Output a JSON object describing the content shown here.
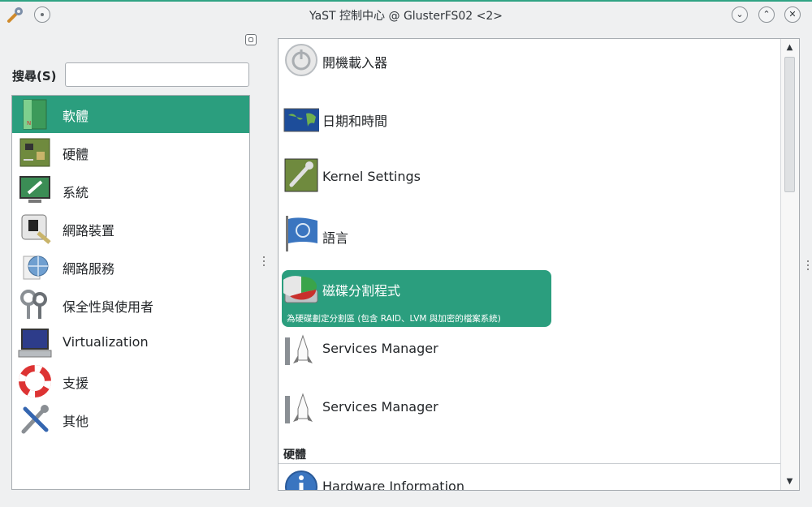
{
  "window": {
    "title": "YaST 控制中心 @ GlusterFS02 <2>",
    "buttons": [
      "chevron-down",
      "chevron-up",
      "close"
    ]
  },
  "search": {
    "label": "搜尋(S)",
    "value": "",
    "placeholder": ""
  },
  "categories": [
    {
      "label": "軟體",
      "icon": "software-package-icon",
      "selected": true
    },
    {
      "label": "硬體",
      "icon": "hardware-board-icon",
      "selected": false
    },
    {
      "label": "系統",
      "icon": "system-monitor-icon",
      "selected": false
    },
    {
      "label": "網路裝置",
      "icon": "network-card-icon",
      "selected": false
    },
    {
      "label": "網路服務",
      "icon": "network-services-icon",
      "selected": false
    },
    {
      "label": "保全性與使用者",
      "icon": "keys-icon",
      "selected": false
    },
    {
      "label": "Virtualization",
      "icon": "laptop-icon",
      "selected": false
    },
    {
      "label": "支援",
      "icon": "lifebuoy-icon",
      "selected": false
    },
    {
      "label": "其他",
      "icon": "tools-icon",
      "selected": false
    }
  ],
  "modules": [
    {
      "label": "開機載入器",
      "icon": "power-icon"
    },
    {
      "label": "日期和時間",
      "icon": "world-map-icon"
    },
    {
      "label": "Kernel Settings",
      "icon": "kernel-chip-icon"
    },
    {
      "label": "語言",
      "icon": "language-flag-icon"
    },
    {
      "label": "磁碟分割程式",
      "icon": "disk-partition-icon",
      "selected": true,
      "description": "為硬碟劃定分割區 (包含 RAID、LVM 與加密的檔案系統)"
    },
    {
      "label": "Services Manager",
      "icon": "services-rocket-icon"
    },
    {
      "label": "Services Manager",
      "icon": "services-rocket-icon"
    }
  ],
  "sections": [
    {
      "title": "硬體",
      "modules": [
        {
          "label": "Hardware Information",
          "icon": "info-icon"
        }
      ]
    }
  ],
  "colors": {
    "accent": "#2b9e7e",
    "titlebar_accent": "#2fa384"
  }
}
